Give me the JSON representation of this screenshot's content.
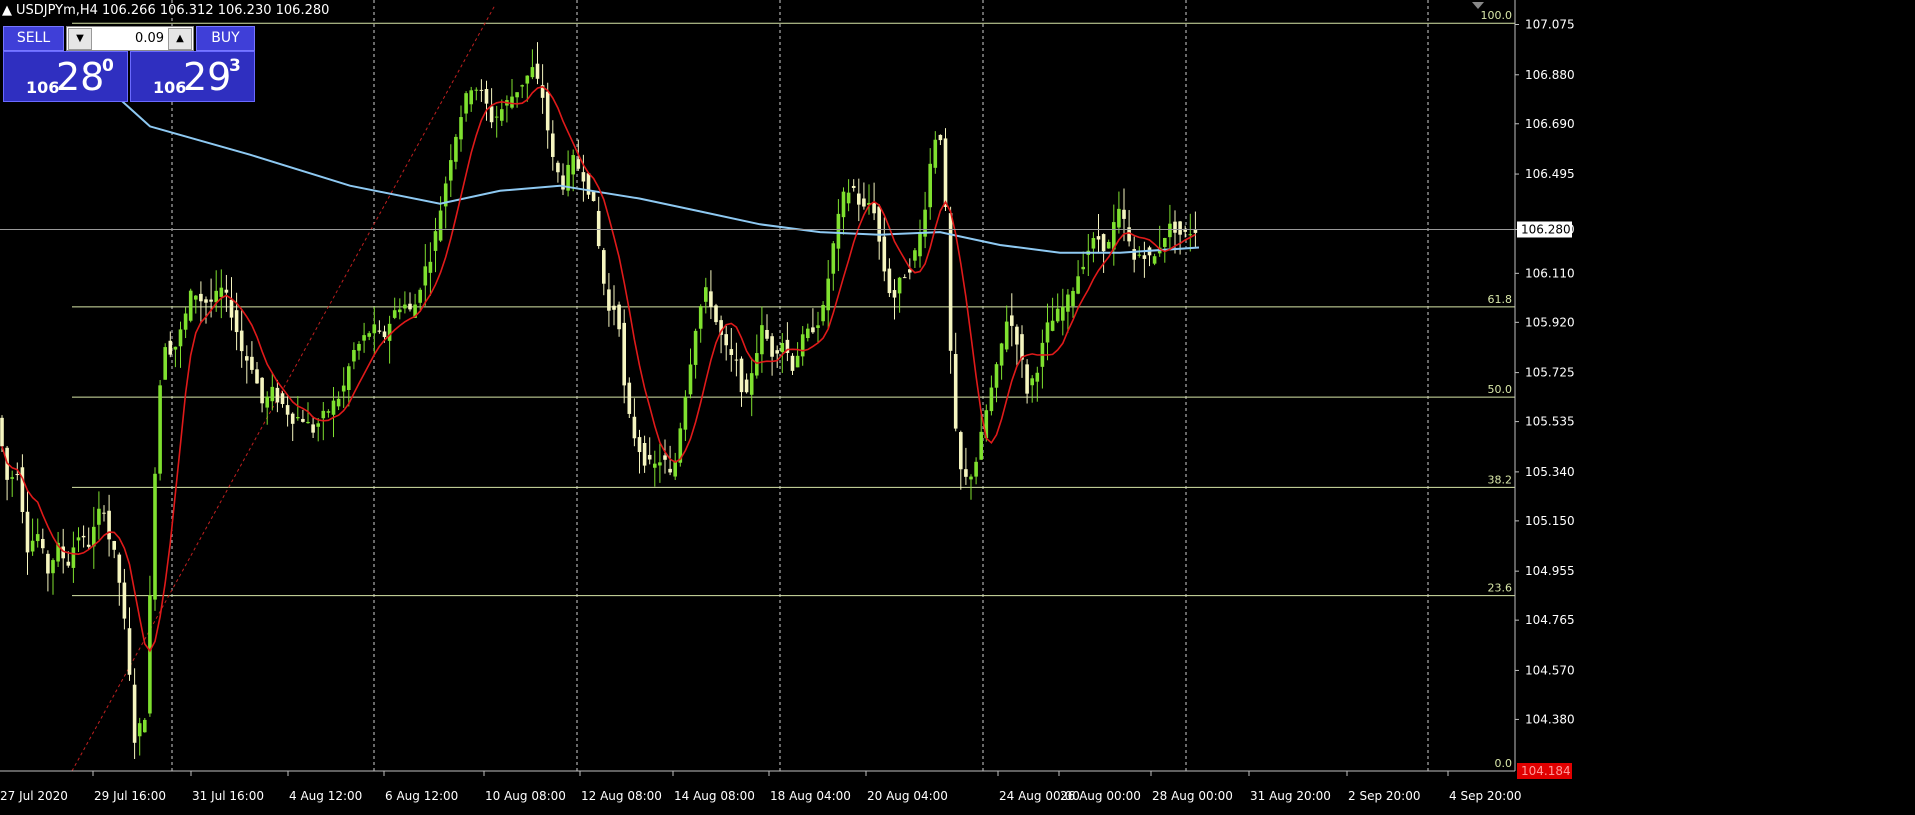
{
  "header": {
    "symbol": "USDJPYm,H4",
    "ohlc": "106.266 106.312 106.230 106.280"
  },
  "trade_panel": {
    "sell_label": "SELL",
    "buy_label": "BUY",
    "lot": "0.09",
    "bid_small": "106",
    "bid_big": "28",
    "bid_sup": "0",
    "ask_small": "106",
    "ask_big": "29",
    "ask_sup": "3"
  },
  "colors": {
    "background": "#000000",
    "bull_candle": "#7fe02f",
    "bear_candle": "#f5f5c0",
    "fast_ma": "#e01a1a",
    "slow_ma": "#8ec9f2",
    "fib_levels": "#d8e6a8",
    "grid": "#d0d0d0",
    "current_price_box": "#ffffff",
    "low_price_box": "#e00000"
  },
  "chart_data": {
    "type": "candlestick",
    "timeframe": "H4",
    "ylim": [
      104.18,
      107.17
    ],
    "price_axis_ticks": [
      "107.075",
      "106.880",
      "106.690",
      "106.495",
      "106.280",
      "106.110",
      "105.920",
      "105.725",
      "105.535",
      "105.340",
      "105.150",
      "104.955",
      "104.765",
      "104.570",
      "104.380"
    ],
    "current_price_label": "106.280",
    "low_price_label": "104.184",
    "time_axis_labels": [
      "27 Jul 2020",
      "29 Jul 16:00",
      "31 Jul 16:00",
      "4 Aug 12:00",
      "6 Aug 12:00",
      "10 Aug 08:00",
      "12 Aug 08:00",
      "14 Aug 08:00",
      "18 Aug 04:00",
      "20 Aug 04:00",
      "24 Aug 00:00",
      "26 Aug 00:00",
      "28 Aug 00:00",
      "31 Aug 20:00",
      "2 Sep 20:00",
      "4 Sep 20:00"
    ],
    "fibonacci": [
      {
        "label": "100.0",
        "price": 107.08
      },
      {
        "label": "61.8",
        "price": 105.98
      },
      {
        "label": "50.0",
        "price": 105.63
      },
      {
        "label": "38.2",
        "price": 105.28
      },
      {
        "label": "23.6",
        "price": 104.86
      },
      {
        "label": "0.0",
        "price": 104.18
      }
    ],
    "price_path": [
      [
        0,
        105.55
      ],
      [
        10,
        105.3
      ],
      [
        20,
        105.35
      ],
      [
        30,
        105.05
      ],
      [
        40,
        105.1
      ],
      [
        50,
        104.95
      ],
      [
        60,
        105.05
      ],
      [
        70,
        104.98
      ],
      [
        80,
        105.1
      ],
      [
        90,
        105.05
      ],
      [
        100,
        105.15
      ],
      [
        105,
        105.25
      ],
      [
        110,
        105.1
      ],
      [
        115,
        105.05
      ],
      [
        120,
        104.95
      ],
      [
        125,
        104.85
      ],
      [
        130,
        104.6
      ],
      [
        135,
        104.45
      ],
      [
        138,
        104.25
      ],
      [
        142,
        104.35
      ],
      [
        146,
        104.3
      ],
      [
        150,
        104.6
      ],
      [
        155,
        105.1
      ],
      [
        160,
        105.6
      ],
      [
        168,
        105.85
      ],
      [
        175,
        105.8
      ],
      [
        185,
        105.9
      ],
      [
        195,
        106.05
      ],
      [
        205,
        106.0
      ],
      [
        215,
        106.0
      ],
      [
        225,
        106.05
      ],
      [
        235,
        105.95
      ],
      [
        245,
        105.8
      ],
      [
        255,
        105.75
      ],
      [
        265,
        105.6
      ],
      [
        275,
        105.65
      ],
      [
        285,
        105.6
      ],
      [
        295,
        105.55
      ],
      [
        305,
        105.55
      ],
      [
        315,
        105.5
      ],
      [
        325,
        105.55
      ],
      [
        335,
        105.6
      ],
      [
        345,
        105.65
      ],
      [
        355,
        105.8
      ],
      [
        365,
        105.85
      ],
      [
        375,
        105.9
      ],
      [
        385,
        105.85
      ],
      [
        395,
        105.95
      ],
      [
        405,
        106.0
      ],
      [
        415,
        105.95
      ],
      [
        425,
        106.1
      ],
      [
        435,
        106.2
      ],
      [
        445,
        106.4
      ],
      [
        455,
        106.6
      ],
      [
        465,
        106.75
      ],
      [
        475,
        106.85
      ],
      [
        485,
        106.8
      ],
      [
        495,
        106.7
      ],
      [
        505,
        106.75
      ],
      [
        515,
        106.8
      ],
      [
        525,
        106.85
      ],
      [
        535,
        106.9
      ],
      [
        545,
        106.8
      ],
      [
        555,
        106.55
      ],
      [
        565,
        106.45
      ],
      [
        575,
        106.55
      ],
      [
        585,
        106.5
      ],
      [
        595,
        106.4
      ],
      [
        605,
        106.1
      ],
      [
        612,
        105.95
      ],
      [
        620,
        106.0
      ],
      [
        628,
        105.6
      ],
      [
        635,
        105.5
      ],
      [
        645,
        105.4
      ],
      [
        655,
        105.35
      ],
      [
        665,
        105.4
      ],
      [
        675,
        105.3
      ],
      [
        680,
        105.45
      ],
      [
        690,
        105.7
      ],
      [
        700,
        105.95
      ],
      [
        710,
        106.05
      ],
      [
        720,
        105.9
      ],
      [
        730,
        105.8
      ],
      [
        740,
        105.75
      ],
      [
        748,
        105.6
      ],
      [
        755,
        105.75
      ],
      [
        765,
        105.9
      ],
      [
        775,
        105.8
      ],
      [
        785,
        105.85
      ],
      [
        795,
        105.75
      ],
      [
        805,
        105.85
      ],
      [
        815,
        105.9
      ],
      [
        825,
        105.95
      ],
      [
        835,
        106.2
      ],
      [
        845,
        106.4
      ],
      [
        855,
        106.45
      ],
      [
        865,
        106.35
      ],
      [
        875,
        106.4
      ],
      [
        885,
        106.15
      ],
      [
        895,
        106.0
      ],
      [
        905,
        106.1
      ],
      [
        915,
        106.15
      ],
      [
        925,
        106.3
      ],
      [
        935,
        106.6
      ],
      [
        942,
        106.7
      ],
      [
        948,
        106.35
      ],
      [
        955,
        105.6
      ],
      [
        962,
        105.35
      ],
      [
        970,
        105.3
      ],
      [
        980,
        105.4
      ],
      [
        990,
        105.6
      ],
      [
        1000,
        105.75
      ],
      [
        1010,
        105.95
      ],
      [
        1020,
        105.85
      ],
      [
        1030,
        105.65
      ],
      [
        1040,
        105.75
      ],
      [
        1050,
        105.9
      ],
      [
        1060,
        105.95
      ],
      [
        1070,
        106.0
      ],
      [
        1080,
        106.1
      ],
      [
        1090,
        106.2
      ],
      [
        1100,
        106.25
      ],
      [
        1110,
        106.2
      ],
      [
        1120,
        106.35
      ],
      [
        1128,
        106.3
      ],
      [
        1135,
        106.15
      ],
      [
        1145,
        106.2
      ],
      [
        1155,
        106.15
      ],
      [
        1165,
        106.25
      ],
      [
        1175,
        106.3
      ],
      [
        1185,
        106.25
      ],
      [
        1195,
        106.28
      ]
    ],
    "slow_ma": [
      [
        110,
        106.82
      ],
      [
        150,
        106.68
      ],
      [
        250,
        106.57
      ],
      [
        350,
        106.45
      ],
      [
        440,
        106.38
      ],
      [
        500,
        106.43
      ],
      [
        560,
        106.45
      ],
      [
        640,
        106.4
      ],
      [
        700,
        106.35
      ],
      [
        760,
        106.3
      ],
      [
        820,
        106.27
      ],
      [
        880,
        106.26
      ],
      [
        940,
        106.27
      ],
      [
        1000,
        106.22
      ],
      [
        1060,
        106.19
      ],
      [
        1120,
        106.19
      ],
      [
        1199,
        106.21
      ]
    ],
    "diagonal_trend": [
      [
        72,
        104.18
      ],
      [
        495,
        107.15
      ]
    ]
  }
}
